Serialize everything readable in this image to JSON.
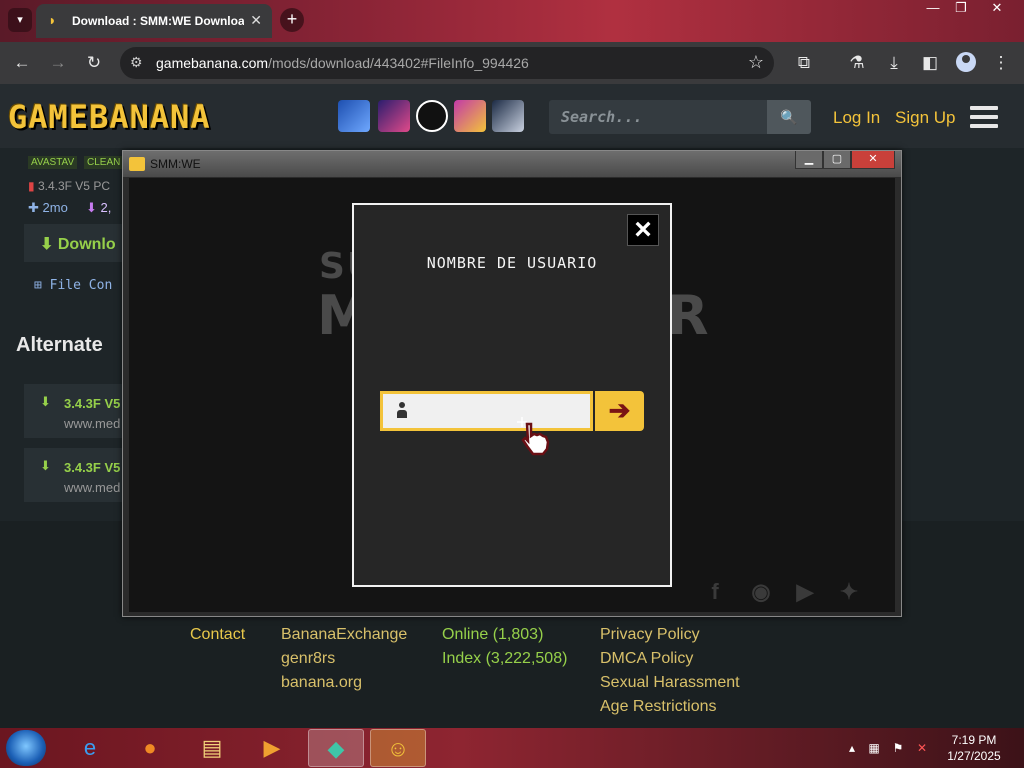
{
  "browser": {
    "tab_title": "Download : SMM:WE Download",
    "url_host": "gamebanana.com",
    "url_path": "/mods/download/443402#FileInfo_994426"
  },
  "site": {
    "logo": "GAMEBANANA",
    "search_placeholder": "Search...",
    "login": "Log In",
    "signup": "Sign Up"
  },
  "page": {
    "badges": [
      "AVASTAV",
      "CLEAN"
    ],
    "file_meta": "3.4.3F V5 PC",
    "age": "2mo",
    "downloads": "2,",
    "download_btn": "Downlo",
    "file_contents": "File Con",
    "alternate_heading": "Alternate",
    "alt_items": [
      {
        "title": "3.4.3F V5",
        "sub": "www.med"
      },
      {
        "title": "3.4.3F V5",
        "sub": "www.med"
      }
    ]
  },
  "footer": {
    "col1": [
      "Contact"
    ],
    "col2": [
      "BananaExchange",
      "genr8rs",
      "banana.org"
    ],
    "col3": [
      "Online (1,803)",
      "Index (3,222,508)"
    ],
    "col4": [
      "Privacy Policy",
      "DMCA Policy",
      "Sexual Harassment",
      "Age Restrictions"
    ]
  },
  "app_window": {
    "title": "SMM:WE",
    "bg_title_1": "SU",
    "bg_title_2": "M",
    "bg_title_3": "R"
  },
  "login_dialog": {
    "title": "NOMBRE DE USUARIO",
    "username_value": "",
    "submit_icon": "arrow-right-icon",
    "close_icon": "close-icon"
  },
  "taskbar": {
    "time": "7:19 PM",
    "date": "1/27/2025"
  },
  "colors": {
    "accent": "#f3c33a",
    "footer_green": "#96d04a",
    "arrow": "#7a1414"
  }
}
